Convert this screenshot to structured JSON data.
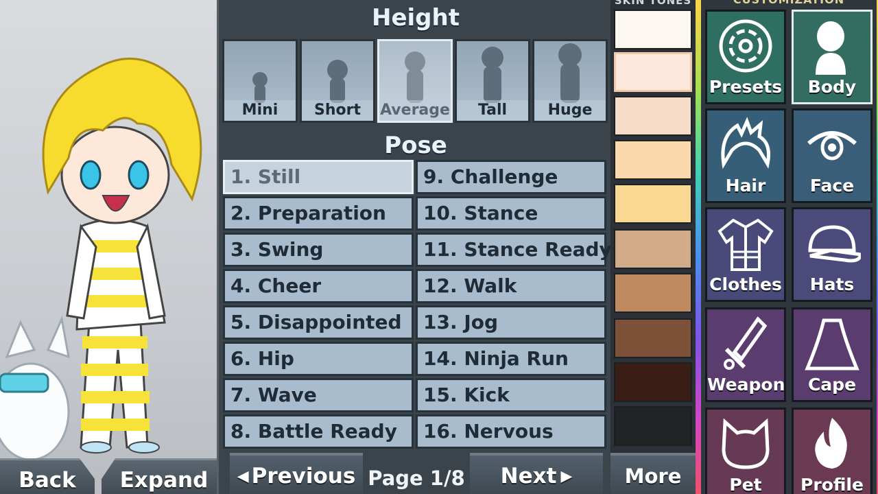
{
  "height": {
    "title": "Height",
    "options": [
      "Mini",
      "Short",
      "Average",
      "Tall",
      "Huge"
    ],
    "selected": "Average"
  },
  "pose": {
    "title": "Pose",
    "options": [
      "1. Still",
      "2. Preparation",
      "3. Swing",
      "4. Cheer",
      "5. Disappointed",
      "6. Hip",
      "7. Wave",
      "8. Battle Ready",
      "9. Challenge",
      "10. Stance",
      "11. Stance Ready",
      "12. Walk",
      "13. Jog",
      "14. Ninja Run",
      "15. Kick",
      "16. Nervous"
    ],
    "selected": "1. Still"
  },
  "pagination": {
    "previous": "Previous",
    "page": "Page 1/8",
    "next": "Next"
  },
  "skin_tones": {
    "title": "SKIN TONES",
    "colors": [
      "#fdf7f1",
      "#fde9dc",
      "#f6dcc6",
      "#fbd8aa",
      "#f9d891",
      "#d2ab88",
      "#bf8a5f",
      "#7d5238",
      "#3a1d14",
      "#222325"
    ],
    "selected_index": 1,
    "more": "More"
  },
  "customization": {
    "title": "CUSTOMIZATION",
    "items": [
      {
        "label": "Presets",
        "icon": "presets-icon",
        "color": "#2f6f61"
      },
      {
        "label": "Body",
        "icon": "body-icon",
        "color": "#336d62"
      },
      {
        "label": "Hair",
        "icon": "hair-icon",
        "color": "#365f77"
      },
      {
        "label": "Face",
        "icon": "eye-icon",
        "color": "#3a5e78"
      },
      {
        "label": "Clothes",
        "icon": "clothes-icon",
        "color": "#4a4a7a"
      },
      {
        "label": "Hats",
        "icon": "cap-icon",
        "color": "#4b4a7b"
      },
      {
        "label": "Weapon",
        "icon": "sword-icon",
        "color": "#5a3c6e"
      },
      {
        "label": "Cape",
        "icon": "cape-icon",
        "color": "#5b3c6e"
      },
      {
        "label": "Pet",
        "icon": "cat-icon",
        "color": "#663a55"
      },
      {
        "label": "Profile",
        "icon": "fire-icon",
        "color": "#6a3a52"
      }
    ],
    "active": "Body"
  },
  "preview": {
    "back": "Back",
    "expand": "Expand"
  }
}
